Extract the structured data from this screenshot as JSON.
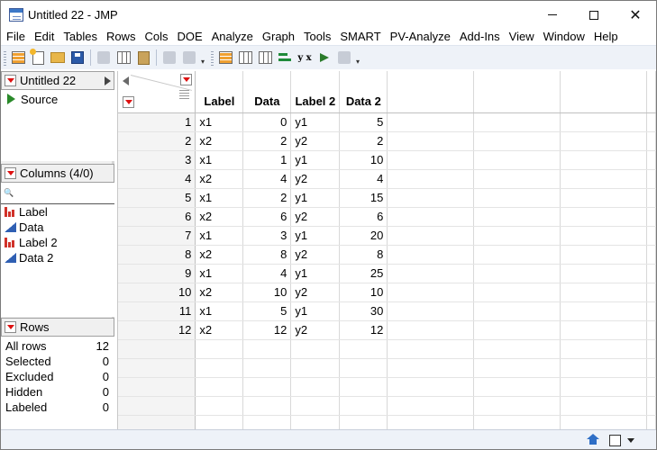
{
  "window": {
    "title": "Untitled 22 - JMP",
    "close_glyph": "✕"
  },
  "menu": [
    "File",
    "Edit",
    "Tables",
    "Rows",
    "Cols",
    "DOE",
    "Analyze",
    "Graph",
    "Tools",
    "SMART",
    "PV-Analyze",
    "Add-Ins",
    "View",
    "Window",
    "Help"
  ],
  "toolbar": {
    "icons": [
      "new-data-table-icon",
      "new-script-icon",
      "open-icon",
      "save-icon",
      "cut-icon",
      "copy-icon",
      "paste-icon",
      "disabled-icon",
      "lock-icon",
      "data-table-icon",
      "data-grid-icon",
      "distribution-icon",
      "fit-y-by-x-icon",
      "fit-model-icon",
      "script-icon",
      "edit-icon"
    ],
    "xy_label": "y x"
  },
  "table_panel": {
    "title": "Untitled 22",
    "source_label": "Source"
  },
  "columns_panel": {
    "title": "Columns (4/0)",
    "search_glyph": "🔍",
    "columns": [
      {
        "name": "Label",
        "type": "nominal"
      },
      {
        "name": "Data",
        "type": "continuous"
      },
      {
        "name": "Label 2",
        "type": "nominal"
      },
      {
        "name": "Data 2",
        "type": "continuous"
      }
    ]
  },
  "rows_panel": {
    "title": "Rows",
    "stats": [
      {
        "label": "All rows",
        "value": "12"
      },
      {
        "label": "Selected",
        "value": "0"
      },
      {
        "label": "Excluded",
        "value": "0"
      },
      {
        "label": "Hidden",
        "value": "0"
      },
      {
        "label": "Labeled",
        "value": "0"
      }
    ]
  },
  "grid": {
    "headers": [
      "Label",
      "Data",
      "Label 2",
      "Data 2"
    ],
    "rows": [
      {
        "n": "1",
        "label": "x1",
        "data": "0",
        "label2": "y1",
        "data2": "5"
      },
      {
        "n": "2",
        "label": "x2",
        "data": "2",
        "label2": "y2",
        "data2": "2"
      },
      {
        "n": "3",
        "label": "x1",
        "data": "1",
        "label2": "y1",
        "data2": "10"
      },
      {
        "n": "4",
        "label": "x2",
        "data": "4",
        "label2": "y2",
        "data2": "4"
      },
      {
        "n": "5",
        "label": "x1",
        "data": "2",
        "label2": "y1",
        "data2": "15"
      },
      {
        "n": "6",
        "label": "x2",
        "data": "6",
        "label2": "y2",
        "data2": "6"
      },
      {
        "n": "7",
        "label": "x1",
        "data": "3",
        "label2": "y1",
        "data2": "20"
      },
      {
        "n": "8",
        "label": "x2",
        "data": "8",
        "label2": "y2",
        "data2": "8"
      },
      {
        "n": "9",
        "label": "x1",
        "data": "4",
        "label2": "y1",
        "data2": "25"
      },
      {
        "n": "10",
        "label": "x2",
        "data": "10",
        "label2": "y2",
        "data2": "10"
      },
      {
        "n": "11",
        "label": "x1",
        "data": "5",
        "label2": "y1",
        "data2": "30"
      },
      {
        "n": "12",
        "label": "x2",
        "data": "12",
        "label2": "y2",
        "data2": "12"
      }
    ]
  }
}
